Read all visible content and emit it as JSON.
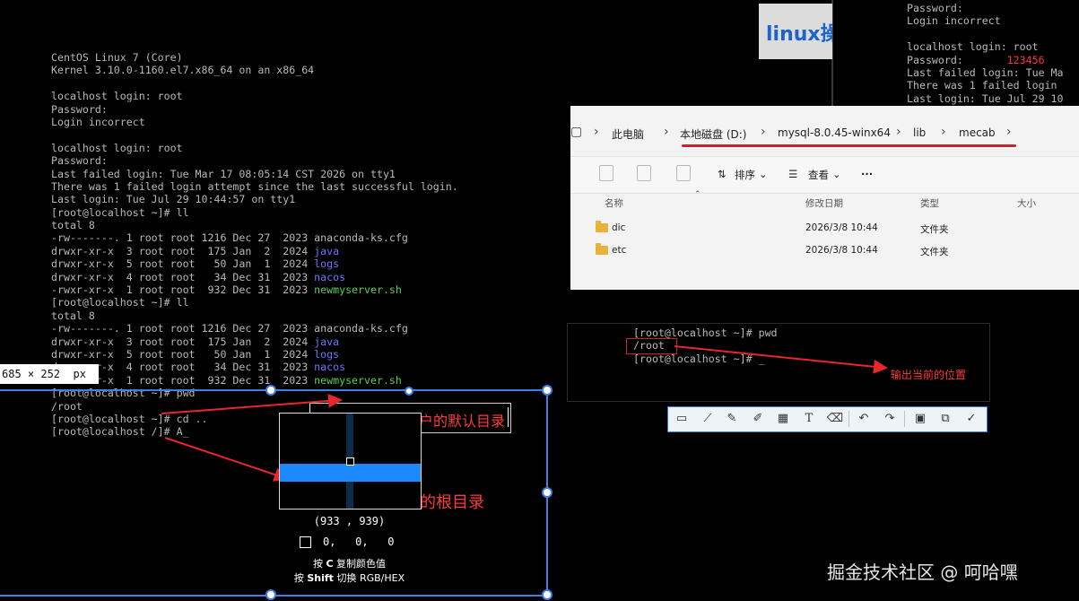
{
  "main_terminal": {
    "lines": [
      [
        {
          "t": "CentOS Linux 7 (Core)"
        }
      ],
      [
        {
          "t": "Kernel 3.10.0-1160.el7.x86_64 on an x86_64"
        }
      ],
      [
        {
          "t": ""
        }
      ],
      [
        {
          "t": "localhost login: root"
        }
      ],
      [
        {
          "t": "Password:"
        }
      ],
      [
        {
          "t": "Login incorrect"
        }
      ],
      [
        {
          "t": ""
        }
      ],
      [
        {
          "t": "localhost login: root"
        }
      ],
      [
        {
          "t": "Password:"
        }
      ],
      [
        {
          "t": "Last failed login: Tue Mar 17 08:05:14 CST 2026 on tty1"
        }
      ],
      [
        {
          "t": "There was 1 failed login attempt since the last successful login."
        }
      ],
      [
        {
          "t": "Last login: Tue Jul 29 10:44:57 on tty1"
        }
      ],
      [
        {
          "t": "[root@localhost ~]# ll"
        }
      ],
      [
        {
          "t": "total 8"
        }
      ],
      [
        {
          "t": "-rw-------. 1 root root 1216 Dec 27  2023 anaconda-ks.cfg"
        }
      ],
      [
        {
          "t": "drwxr-xr-x  3 root root  175 Jan  2  2024 "
        },
        {
          "t": "java",
          "c": "blue"
        }
      ],
      [
        {
          "t": "drwxr-xr-x  5 root root   50 Jan  1  2024 "
        },
        {
          "t": "logs",
          "c": "blue"
        }
      ],
      [
        {
          "t": "drwxr-xr-x  4 root root   34 Dec 31  2023 "
        },
        {
          "t": "nacos",
          "c": "blue"
        }
      ],
      [
        {
          "t": "-rwxr-xr-x  1 root root  932 Dec 31  2023 "
        },
        {
          "t": "newmyserver.sh",
          "c": "green"
        }
      ],
      [
        {
          "t": "[root@localhost ~]# ll"
        }
      ],
      [
        {
          "t": "total 8"
        }
      ],
      [
        {
          "t": "-rw-------. 1 root root 1216 Dec 27  2023 anaconda-ks.cfg"
        }
      ],
      [
        {
          "t": "drwxr-xr-x  3 root root  175 Jan  2  2024 "
        },
        {
          "t": "java",
          "c": "blue"
        }
      ],
      [
        {
          "t": "drwxr-xr-x  5 root root   50 Jan  1  2024 "
        },
        {
          "t": "logs",
          "c": "blue"
        }
      ],
      [
        {
          "t": "drwxr-xr-x  4 root root   34 Dec 31  2023 "
        },
        {
          "t": "nacos",
          "c": "blue"
        }
      ],
      [
        {
          "t": "-rwxr-xr-x  1 root root  932 Dec 31  2023 "
        },
        {
          "t": "newmyserver.sh",
          "c": "green"
        }
      ],
      [
        {
          "t": "[root@localhost ~]# pwd"
        }
      ],
      [
        {
          "t": "/root"
        }
      ],
      [
        {
          "t": "[root@localhost ~]# cd .."
        }
      ],
      [
        {
          "t": "[root@localhost /]# A_"
        }
      ]
    ]
  },
  "top_right_terminal": {
    "lines": [
      [
        {
          "t": "Password:"
        }
      ],
      [
        {
          "t": "Login incorrect"
        }
      ],
      [
        {
          "t": ""
        }
      ],
      [
        {
          "t": "localhost login: root"
        }
      ],
      [
        {
          "t": "Password:       "
        },
        {
          "t": "123456",
          "c": "red"
        }
      ],
      [
        {
          "t": "Last failed login: Tue Ma"
        }
      ],
      [
        {
          "t": "There was 1 failed login"
        }
      ],
      [
        {
          "t": "Last login: Tue Jul 29 10"
        }
      ]
    ]
  },
  "linux_thumbnail": {
    "text": "linux操"
  },
  "explorer": {
    "breadcrumb": [
      "此电脑",
      "本地磁盘 (D:)",
      "mysql-8.0.45-winx64",
      "lib",
      "mecab"
    ],
    "toolbar": {
      "sort": "排序",
      "view": "查看",
      "more": "···"
    },
    "columns": {
      "name": "名称",
      "modified": "修改日期",
      "type": "类型",
      "size": "大小"
    },
    "rows": [
      {
        "name": "dic",
        "modified": "2026/3/8 10:44",
        "type": "文件夹"
      },
      {
        "name": "etc",
        "modified": "2026/3/8 10:44",
        "type": "文件夹"
      }
    ]
  },
  "mid_terminal": {
    "lines": [
      [
        {
          "t": "[root@localhost ~]# pwd"
        }
      ],
      [
        {
          "t": "/root"
        }
      ],
      [
        {
          "t": "[root@localhost ~]# _"
        }
      ]
    ],
    "annotation": "输出当前的位置"
  },
  "size_badge": "685 × 252  px",
  "annotations": {
    "text1": "户的默认目录",
    "text2": "的根目录"
  },
  "magnifier": {
    "coords": "(933 , 939)",
    "rgb": "0,   0,   0",
    "hint1_pre": "按 ",
    "hint1_key": "C",
    "hint1_post": " 复制颜色值",
    "hint2_pre": "按 ",
    "hint2_key": "Shift",
    "hint2_post": " 切换 RGB/HEX"
  },
  "annotation_toolbar": {
    "tools": [
      "rect-tool-icon",
      "line-tool-icon",
      "pen-tool-icon",
      "marker-tool-icon",
      "mosaic-tool-icon",
      "text-tool-icon",
      "eraser-tool-icon",
      "undo-icon",
      "redo-icon",
      "save-icon",
      "copy-icon",
      "confirm-icon"
    ]
  },
  "watermark": "掘金技术社区 @ 呵哈嘿",
  "colors": {
    "accent_red": "#ff3a3a",
    "selection_blue": "#3d7fe6",
    "dir_blue": "#6f74ff",
    "exec_green": "#4fd24f"
  }
}
